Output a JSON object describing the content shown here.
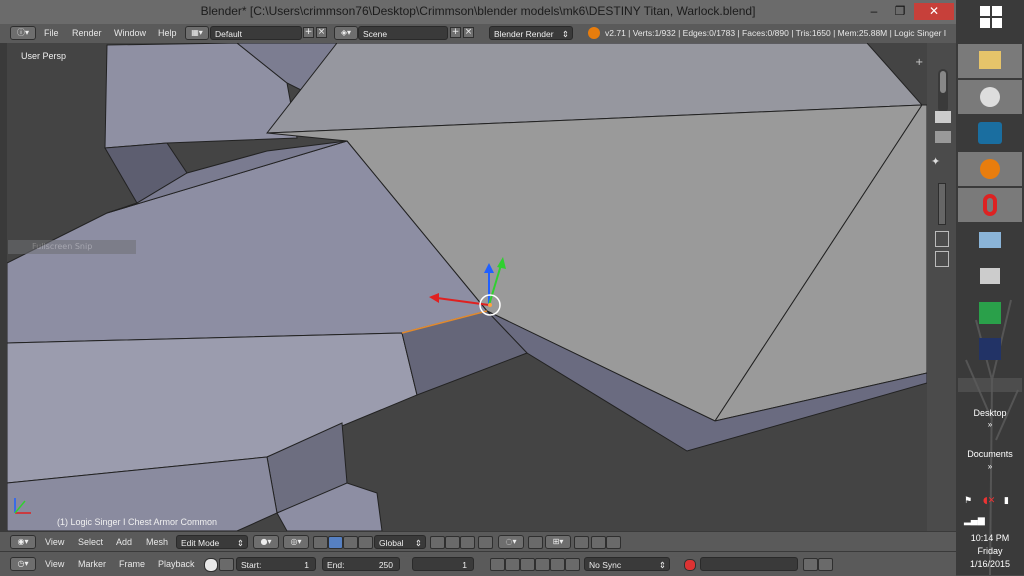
{
  "window": {
    "title": "Blender* [C:\\Users\\crimmson76\\Desktop\\Crimmson\\blender models\\mk6\\DESTINY Titan, Warlock.blend]",
    "minimize": "–",
    "restore": "❐",
    "close": "✕"
  },
  "menubar": {
    "items": [
      "File",
      "Render",
      "Window",
      "Help"
    ],
    "layout": "Default",
    "scene": "Scene",
    "render_engine": "Blender Render",
    "stats": "v2.71 | Verts:1/932 | Edges:0/1783 | Faces:0/890 | Tris:1650 | Mem:25.88M | Logic Singer I"
  },
  "viewport": {
    "label": "User Persp",
    "object_label": "(1) Logic Singer I Chest Armor Common",
    "ghost_text": "Fullscreen Snip"
  },
  "view3d_header": {
    "items": [
      "View",
      "Select",
      "Add",
      "Mesh"
    ],
    "mode": "Edit Mode",
    "orientation": "Global"
  },
  "timeline_header": {
    "items": [
      "View",
      "Marker",
      "Frame",
      "Playback"
    ],
    "start_label": "Start:",
    "start_value": "1",
    "end_label": "End:",
    "end_value": "250",
    "current_frame": "1",
    "sync": "No Sync"
  },
  "taskbar": {
    "desktop_label": "Desktop",
    "documents_label": "Documents",
    "time": "10:14 PM",
    "day": "Friday",
    "date": "1/16/2015"
  },
  "colors": {
    "mesh_light": "#9899a8",
    "mesh_mid": "#8c8da0",
    "mesh_dark": "#636476",
    "background": "#444444",
    "gizmo_x": "#e02020",
    "gizmo_y": "#30d030",
    "gizmo_z": "#2060ff"
  }
}
